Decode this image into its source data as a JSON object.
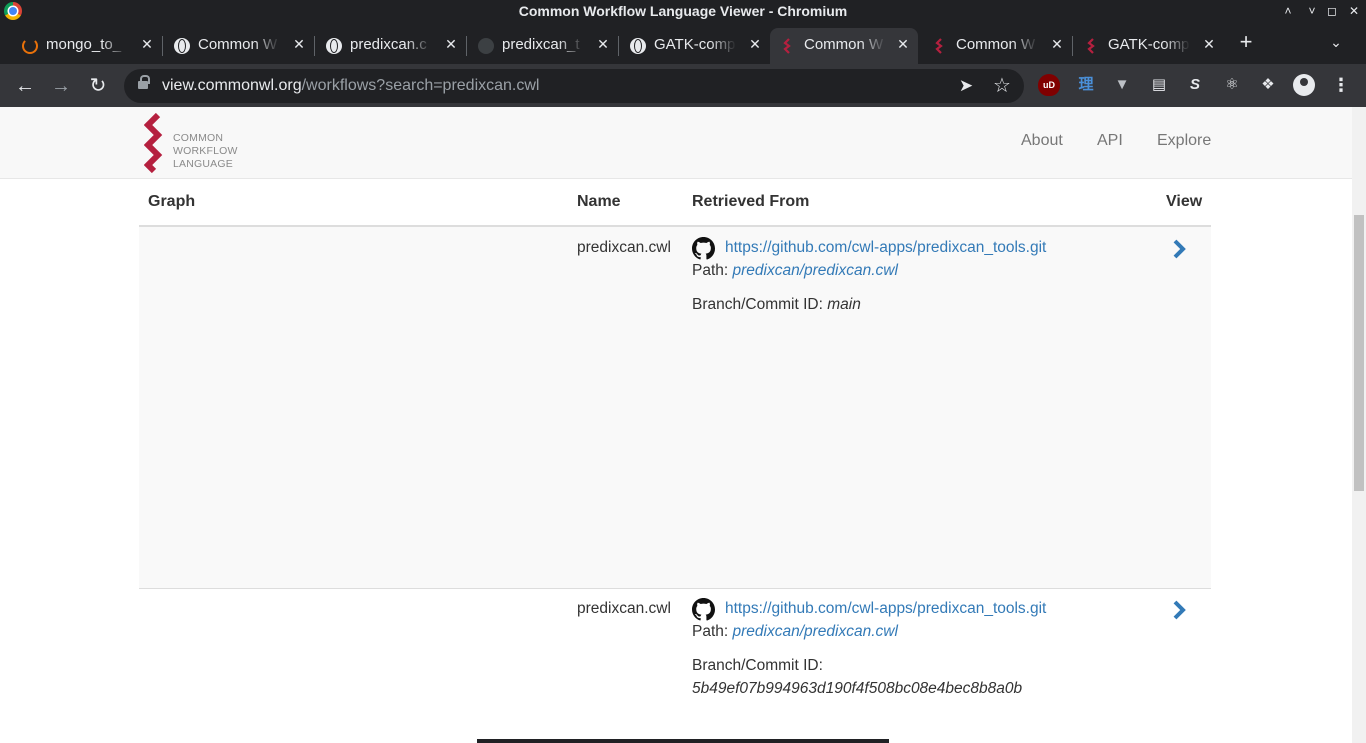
{
  "window": {
    "title": "Common Workflow Language Viewer - Chromium",
    "controls": [
      "˄",
      "˅",
      "◻",
      "✕"
    ]
  },
  "tabs": [
    {
      "label": "mongo_to_",
      "icon": "mongo-icon",
      "active": false
    },
    {
      "label": "Common W",
      "icon": "globe-icon",
      "active": false
    },
    {
      "label": "predixcan.c",
      "icon": "globe-icon",
      "active": false
    },
    {
      "label": "predixcan_t",
      "icon": "github-icon",
      "active": false
    },
    {
      "label": "GATK-comp",
      "icon": "globe-icon",
      "active": false
    },
    {
      "label": "Common W",
      "icon": "cwl-icon",
      "active": true
    },
    {
      "label": "Common W",
      "icon": "cwl-icon",
      "active": false
    },
    {
      "label": "GATK-comp",
      "icon": "cwl-icon",
      "active": false
    }
  ],
  "tab_close_glyph": "✕",
  "new_tab_glyph": "+",
  "tab_menu_glyph": "⌄",
  "toolbar": {
    "back": "←",
    "forward": "→",
    "reload": "↻",
    "url_host": "view.commonwl.org",
    "url_path": "/workflows?search=predixcan.cwl",
    "send_glyph": "➤",
    "star_glyph": "☆",
    "extensions": [
      "uD",
      "理",
      "▼",
      "▤",
      "S",
      "⚛",
      "❖"
    ],
    "menu_glyph": "⋮"
  },
  "site": {
    "logo_lines": [
      "COMMON",
      "WORKFLOW",
      "LANGUAGE"
    ],
    "brand_color": "#b5203f",
    "nav": [
      "About",
      "API",
      "Explore"
    ]
  },
  "table": {
    "headers": {
      "graph": "Graph",
      "name": "Name",
      "retrieved": "Retrieved From",
      "view": "View"
    },
    "rows": [
      {
        "name": "predixcan.cwl",
        "repo_url": "https://github.com/cwl-apps/predixcan_tools.git",
        "path_label": "Path:",
        "path": "predixcan/predixcan.cwl",
        "branch_label": "Branch/Commit ID:",
        "branch": "main"
      },
      {
        "name": "predixcan.cwl",
        "repo_url": "https://github.com/cwl-apps/predixcan_tools.git",
        "path_label": "Path:",
        "path": "predixcan/predixcan.cwl",
        "branch_label": "Branch/Commit ID:",
        "branch": "5b49ef07b994963d190f4f508bc08e4bec8b8a0b"
      }
    ]
  },
  "colors": {
    "link": "#337ab7",
    "chrome_dark": "#202124",
    "chrome_toolbar": "#35363a"
  }
}
